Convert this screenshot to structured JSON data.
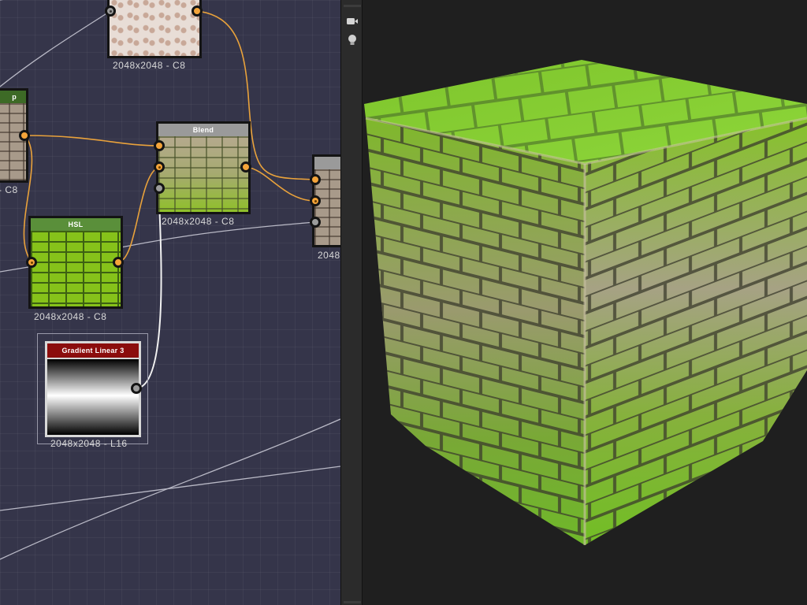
{
  "graph": {
    "nodes": {
      "top": {
        "caption": "2048x2048 - C8"
      },
      "left": {
        "title": "p",
        "caption": "- C8"
      },
      "blend": {
        "title": "Blend",
        "caption": "2048x2048 - C8"
      },
      "right": {
        "caption": "2048"
      },
      "hsl": {
        "title": "HSL",
        "caption": "2048x2048 - C8"
      },
      "gradient": {
        "title": "Gradient Linear 3",
        "caption": "2048x2048 - L16"
      }
    }
  },
  "toolbar": {
    "icons": [
      "camera-icon",
      "light-bulb-icon"
    ]
  },
  "colors": {
    "graph_bg": "#35354a",
    "port_orange": "#f4a43a",
    "port_grey": "#9c9c9c",
    "blend_header": "#9a9a9a",
    "hsl_header": "#5a8f3a",
    "gradient_header": "#8b0d0d",
    "viewport_bg": "#1f1f1f"
  }
}
